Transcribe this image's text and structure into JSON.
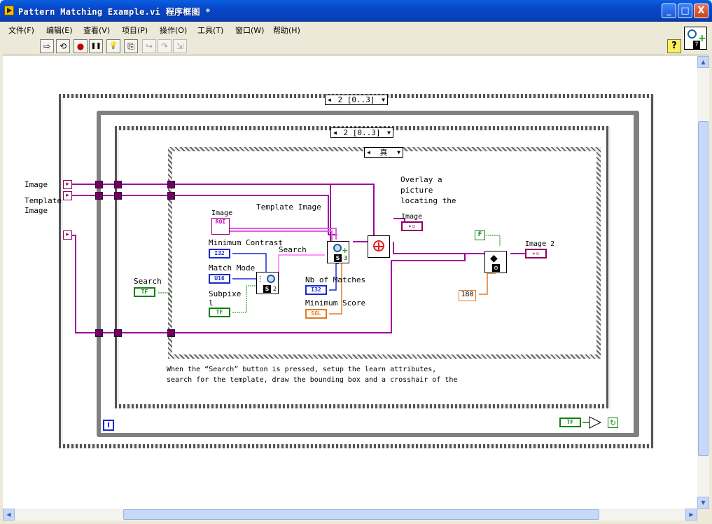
{
  "window": {
    "title": "Pattern Matching Example.vi 程序框图 *",
    "minimize": "_",
    "maximize": "□",
    "close": "X"
  },
  "menu": [
    "文件(F)",
    "编辑(E)",
    "查看(V)",
    "项目(P)",
    "操作(O)",
    "工具(T)",
    "窗口(W)",
    "帮助(H)"
  ],
  "toolbar": {
    "run": "⇨",
    "run_continuous": "⟲",
    "abort": "●",
    "pause": "❚❚",
    "highlight": "💡",
    "retain": "⎘",
    "step_into": "↪",
    "step_over": "↷",
    "step_out": "⇲",
    "help": "?"
  },
  "diagram": {
    "outer_sequence_selector": "2 [0..3]",
    "inner_sequence_selector": "2 [0..3]",
    "case_selector": "真",
    "labels": {
      "image": "Image",
      "template_image_1": "Template",
      "template_image_2": "Image",
      "search": "Search",
      "image_small": "Image",
      "template_image_label": "Template Image",
      "minimum_contrast": "Minimum Contrast",
      "search_label": "Search",
      "match_mode": "Match Mode",
      "subpixel_1": "Subpixe",
      "subpixel_2": "l",
      "nb_of_matches": "Nb of Matches",
      "minimum_score": "Minimum Score",
      "overlay_1": "Overlay a",
      "overlay_2": "picture",
      "overlay_3": "locating the",
      "image_out": "Image",
      "image2": "Image 2"
    },
    "terminals": {
      "roi": "ROI",
      "i32": "I32",
      "u16": "U16",
      "tf": "TF",
      "sgl": "SGL",
      "const_180": "180",
      "false_const": "F",
      "iter": "i",
      "s3": "S",
      "s2": "S",
      "n3": "3",
      "n2": "2"
    },
    "comment_1": "When the “Search” button is pressed, setup the learn attributes,",
    "comment_2": "search for the template, draw the bounding box and a crosshair of the"
  }
}
